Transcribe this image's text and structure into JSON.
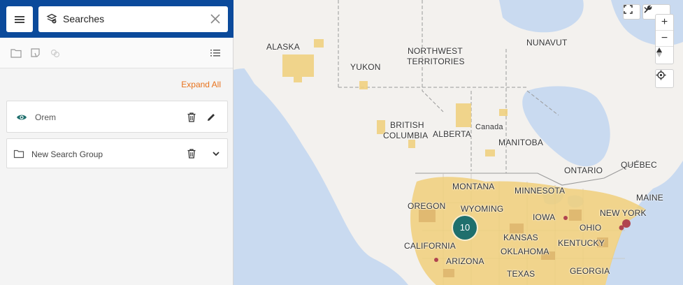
{
  "search": {
    "title": "Searches",
    "icon": "layers-icon"
  },
  "toolbar": {
    "icons": [
      "folder-icon",
      "new-search-icon",
      "link-icon",
      "list-icon"
    ]
  },
  "expand_all_label": "Expand All",
  "items": [
    {
      "name": "Orem",
      "type": "search",
      "icons": [
        "eye-icon",
        "trash-icon",
        "pencil-icon"
      ]
    },
    {
      "name": "New Search Group",
      "type": "group",
      "icons": [
        "folder-icon",
        "trash-icon",
        "chevron-down-icon"
      ]
    }
  ],
  "map": {
    "labels": {
      "alaska": "ALASKA",
      "northwest": "NORTHWEST",
      "territories": "TERRITORIES",
      "nunavut": "NUNAVUT",
      "yukon": "YUKON",
      "british": "BRITISH",
      "columbia": "COLUMBIA",
      "alberta": "ALBERTA",
      "canada": "Canada",
      "manitoba": "MANITOBA",
      "ontario": "ONTARIO",
      "quebec": "QUÉBEC",
      "montana": "MONTANA",
      "minnesota": "MINNESOTA",
      "maine": "MAINE",
      "oregon": "OREGON",
      "wyoming": "WYOMING",
      "new_york": "NEW YORK",
      "iowa": "IOWA",
      "ohio": "OHIO",
      "california": "CALIFORNIA",
      "kansas": "KANSAS",
      "kentucky": "KENTUCKY",
      "oklahoma": "OKLAHOMA",
      "arizona": "ARIZONA",
      "texas": "TEXAS",
      "georgia": "GEORGIA"
    },
    "cluster_count": "10",
    "controls": {
      "zoom_in": "+",
      "zoom_out": "−"
    },
    "colors": {
      "water": "#c9daf0",
      "land": "#f3f1ee",
      "density": "#f0cf7a",
      "hot": "#b0444f",
      "cluster": "#1f6f6d"
    }
  }
}
